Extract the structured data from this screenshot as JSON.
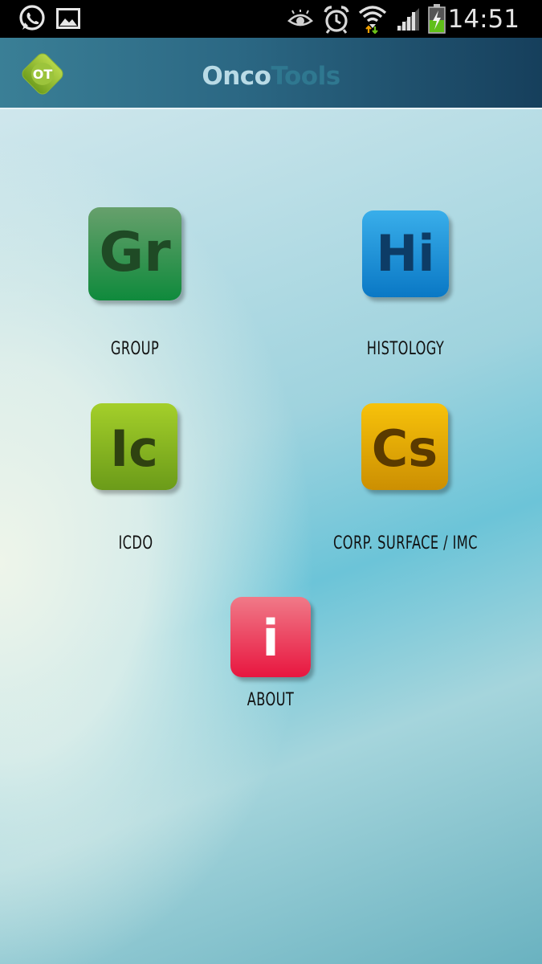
{
  "status_bar": {
    "time": "14:51",
    "icons": [
      "whatsapp-icon",
      "gallery-icon",
      "eye-icon",
      "alarm-icon",
      "wifi-icon",
      "signal-icon",
      "battery-charging-icon"
    ]
  },
  "action_bar": {
    "logo_text": "OT",
    "title_part1": "Onco",
    "title_part2": "Tools"
  },
  "tiles": [
    {
      "abbr": "Gr",
      "label": "GROUP",
      "color_top": "#67a06c",
      "color_bottom": "#0f8a3c",
      "text_color": "#1f4a25"
    },
    {
      "abbr": "Hi",
      "label": "HISTOLOGY",
      "color_top": "#39aeea",
      "color_bottom": "#0a78c5",
      "text_color": "#0d3c66"
    },
    {
      "abbr": "Ic",
      "label": "ICDO",
      "color_top": "#a4cf2a",
      "color_bottom": "#6b9b19",
      "text_color": "#2f4210"
    },
    {
      "abbr": "Cs",
      "label": "CORP. SURFACE / IMC",
      "color_top": "#f7c20a",
      "color_bottom": "#cc8f02",
      "text_color": "#5a3a00"
    },
    {
      "abbr": "i",
      "label": "ABOUT",
      "color_top": "#f07a88",
      "color_bottom": "#e8163f",
      "text_color": "#ffffff"
    }
  ]
}
